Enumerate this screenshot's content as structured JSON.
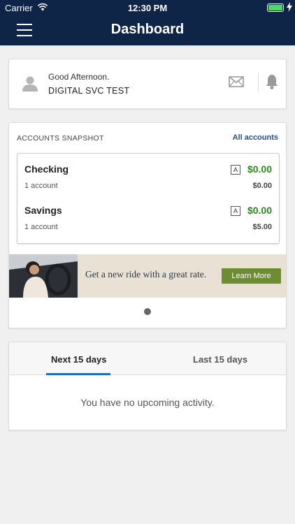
{
  "status_bar": {
    "carrier": "Carrier",
    "time": "12:30 PM",
    "battery_level": 1.0
  },
  "nav": {
    "title": "Dashboard"
  },
  "greeting": {
    "salutation": "Good Afternoon.",
    "name": "DIGITAL SVC TEST"
  },
  "snapshot": {
    "heading": "ACCOUNTS SNAPSHOT",
    "all_link": "All accounts",
    "accounts": [
      {
        "name": "Checking",
        "count": "1 account",
        "badge": "A",
        "balance": "$0.00",
        "secondary_balance": "$0.00"
      },
      {
        "name": "Savings",
        "count": "1 account",
        "badge": "A",
        "balance": "$0.00",
        "secondary_balance": "$5.00"
      }
    ]
  },
  "banner": {
    "text": "Get a new ride with a great rate.",
    "button": "Learn More"
  },
  "activity": {
    "tabs": [
      {
        "label": "Next 15 days"
      },
      {
        "label": "Last 15 days"
      }
    ],
    "empty_message": "You have no upcoming activity."
  },
  "colors": {
    "nav_bg": "#0f2548",
    "balance_green": "#2b8a1b",
    "link_blue": "#1f4f8e",
    "cta_green": "#6e8d32",
    "tab_active": "#1f6fbf"
  }
}
